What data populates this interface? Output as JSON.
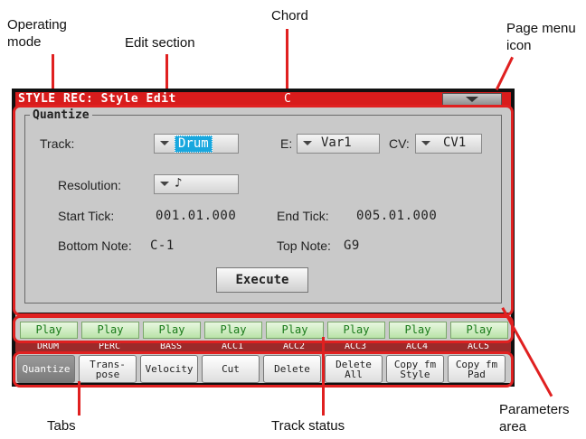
{
  "callouts": {
    "operating_mode": "Operating\nmode",
    "edit_section": "Edit section",
    "chord": "Chord",
    "page_menu_icon": "Page menu\nicon",
    "tabs": "Tabs",
    "track_status": "Track status",
    "parameters_area": "Parameters\narea"
  },
  "titlebar": {
    "title": "STYLE REC: Style Edit",
    "chord": "C"
  },
  "quantize": {
    "group_label": "Quantize",
    "track_label": "Track:",
    "track_value": "Drum",
    "e_label": "E:",
    "e_value": "Var1",
    "cv_label": "CV:",
    "cv_value": "CV1",
    "resolution_label": "Resolution:",
    "resolution_value": "♪",
    "start_tick_label": "Start Tick:",
    "start_tick_value": "001.01.000",
    "end_tick_label": "End Tick:",
    "end_tick_value": "005.01.000",
    "bottom_note_label": "Bottom Note:",
    "bottom_note_value": "C-1",
    "top_note_label": "Top Note:",
    "top_note_value": "G9",
    "execute_label": "Execute"
  },
  "tracks": [
    {
      "status": "Play",
      "name": "DRUM"
    },
    {
      "status": "Play",
      "name": "PERC"
    },
    {
      "status": "Play",
      "name": "BASS"
    },
    {
      "status": "Play",
      "name": "ACC1"
    },
    {
      "status": "Play",
      "name": "ACC2"
    },
    {
      "status": "Play",
      "name": "ACC3"
    },
    {
      "status": "Play",
      "name": "ACC4"
    },
    {
      "status": "Play",
      "name": "ACC5"
    }
  ],
  "tabs": [
    {
      "label": "Quantize",
      "active": true
    },
    {
      "label": "Trans-\npose",
      "active": false
    },
    {
      "label": "Velocity",
      "active": false
    },
    {
      "label": "Cut",
      "active": false
    },
    {
      "label": "Delete",
      "active": false
    },
    {
      "label": "Delete\nAll",
      "active": false
    },
    {
      "label": "Copy fm\nStyle",
      "active": false
    },
    {
      "label": "Copy fm\nPad",
      "active": false
    }
  ],
  "colors": {
    "titlebar": "#d81c1c",
    "annotation": "#e02020",
    "play_text": "#1a7a1a",
    "selected": "#18a7de"
  }
}
